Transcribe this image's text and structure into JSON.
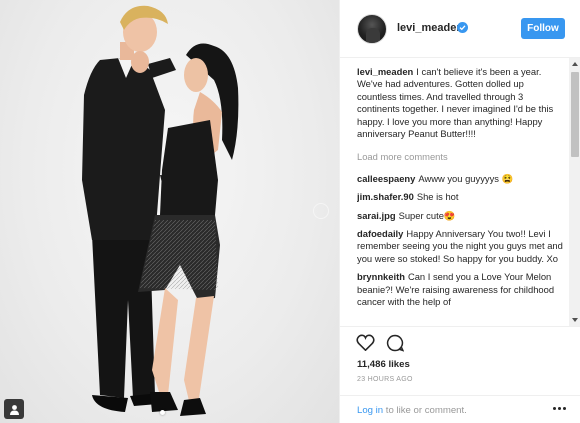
{
  "post": {
    "username": "levi_meaden",
    "follow_label": "Follow",
    "caption": {
      "user": "levi_meaden",
      "text": "I can't believe it's been a year. We've had adventures. Gotten dolled up countless times. And travelled through 3 continents together. I never imagined I'd be this happy. I love you more than anything! Happy anniversary Peanut Butter!!!!"
    },
    "load_more": "Load more comments",
    "comments": [
      {
        "user": "calleespaeny",
        "text": "Awww you guyyyys 😫"
      },
      {
        "user": "jim.shafer.90",
        "text": "She is hot"
      },
      {
        "user": "sarai.jpg",
        "text": "Super cute😍"
      },
      {
        "user": "dafoedaily",
        "text": "Happy Anniversary You two!! Levi I remember seeing you the night you guys met and you were so stoked! So happy for you buddy. Xo"
      },
      {
        "user": "brynnkeith",
        "text": "Can I send you a Love Your Melon beanie?! We're raising awareness for childhood cancer with the help of"
      }
    ],
    "likes": "11,486 likes",
    "timestamp": "23 HOURS AGO",
    "login_link": "Log in",
    "login_suffix": " to like or comment."
  },
  "colors": {
    "accent": "#3897f0",
    "muted": "#999999",
    "text": "#262626"
  },
  "icons": [
    "verified-badge-icon",
    "heart-icon",
    "comment-icon",
    "more-options-icon",
    "user-tag-icon"
  ]
}
